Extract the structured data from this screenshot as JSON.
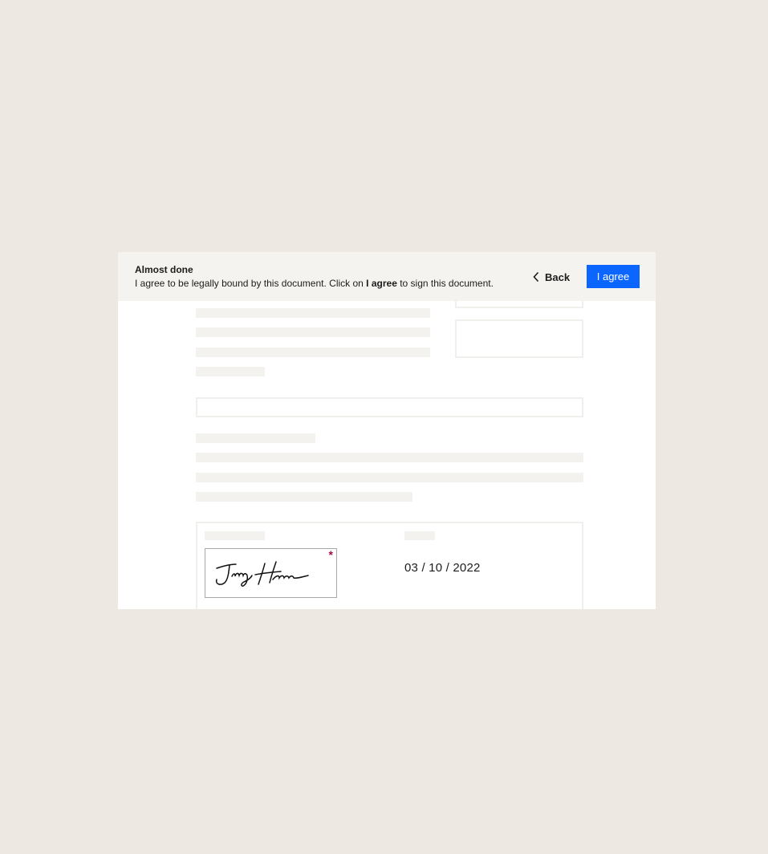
{
  "banner": {
    "title": "Almost done",
    "message_prefix": "I agree to be legally bound by this document. Click on ",
    "message_bold": "I agree",
    "message_suffix": " to sign this document.",
    "back_label": "Back",
    "agree_label": "I agree"
  },
  "signature": {
    "signer_name": "Jenny Harmon",
    "required_marker": "*",
    "date": "03 / 10 / 2022"
  },
  "colors": {
    "page_background": "#ede8e1",
    "banner_background": "#f5f3ef",
    "primary_button": "#0a66ff",
    "required_marker": "#a30d4a"
  },
  "icons": {
    "back": "chevron-left-icon"
  }
}
